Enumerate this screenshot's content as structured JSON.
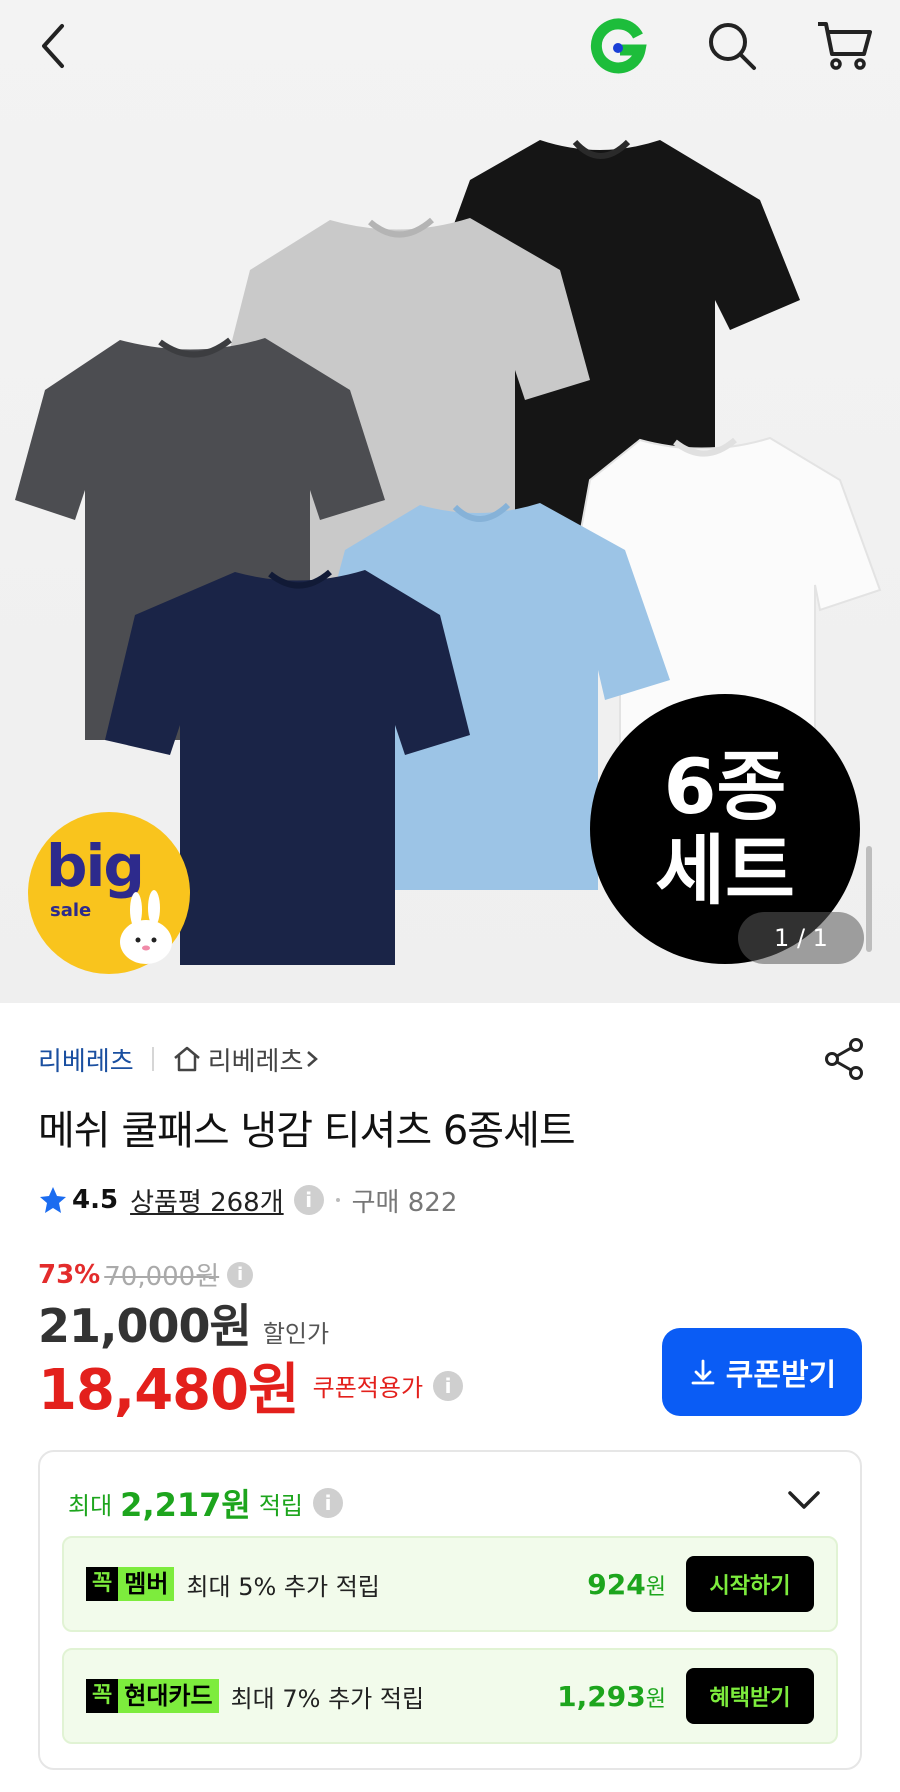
{
  "topbar": {
    "back_icon": "back-arrow-icon",
    "brand_logo_text": "G",
    "brand_color": "#1dbd3b",
    "search_icon": "search-icon",
    "cart_icon": "cart-icon"
  },
  "hero": {
    "badge_line1": "6종",
    "badge_line2": "세트",
    "promo_big": "big",
    "promo_sale": "sale",
    "counter": "1 / 1"
  },
  "product": {
    "seller": "리베레츠",
    "shop_link": "리베레츠",
    "title": "메쉬 쿨패스 냉감 티셔츠 6종세트",
    "rating": "4.5",
    "reviews": "상품평 268개",
    "purchases": "구매 822",
    "discount_rate": "73%",
    "original_price": "70,000원",
    "sale_price": "21,000원",
    "sale_price_label": "할인가",
    "coupon_price": "18,480원",
    "coupon_price_label": "쿠폰적용가",
    "coupon_button": "쿠폰받기"
  },
  "rewards": {
    "prefix": "최대",
    "amount": "2,217원",
    "suffix": "적립",
    "items": [
      {
        "tag_mark": "꼭",
        "tag_text": "멤버",
        "desc": "최대 5% 추가 적립",
        "amount": "924",
        "unit": "원",
        "button": "시작하기"
      },
      {
        "tag_mark": "꼭",
        "tag_text": "현대카드",
        "desc": "최대 7% 추가 적립",
        "amount": "1,293",
        "unit": "원",
        "button": "혜택받기"
      }
    ]
  },
  "colors": {
    "accent_blue": "#0a5cf5",
    "price_red": "#e3201c",
    "reward_green": "#1da51d",
    "tag_green": "#7dec3d"
  }
}
